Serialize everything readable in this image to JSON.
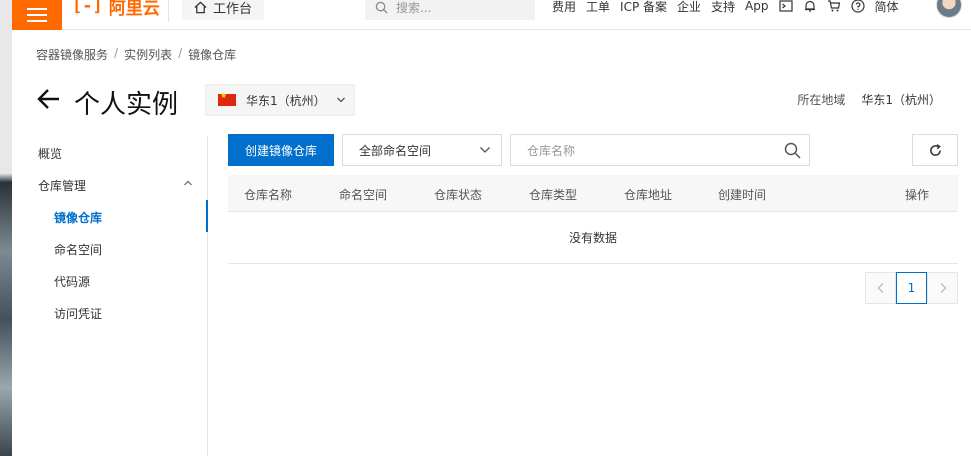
{
  "topbar": {
    "logo_mark": "[-]",
    "logo_text": "阿里云",
    "workbench_label": "工作台",
    "search_placeholder": "搜索...",
    "nav": [
      "费用",
      "工单",
      "ICP 备案",
      "企业",
      "支持",
      "App"
    ],
    "lang_label": "简体"
  },
  "breadcrumb": [
    "容器镜像服务",
    "实例列表",
    "镜像仓库"
  ],
  "page": {
    "title": "个人实例",
    "region_select": "华东1（杭州）",
    "region_meta_label": "所在地域",
    "region_meta_value": "华东1（杭州）"
  },
  "sidebar": {
    "items": [
      {
        "label": "概览"
      },
      {
        "label": "仓库管理"
      },
      {
        "label": "镜像仓库"
      },
      {
        "label": "命名空间"
      },
      {
        "label": "代码源"
      },
      {
        "label": "访问凭证"
      }
    ]
  },
  "toolbar": {
    "create_label": "创建镜像仓库",
    "namespace_select": "全部命名空间",
    "search_placeholder": "仓库名称"
  },
  "table": {
    "columns": [
      "仓库名称",
      "命名空间",
      "仓库状态",
      "仓库类型",
      "仓库地址",
      "创建时间",
      "操作"
    ],
    "empty_text": "没有数据"
  },
  "pagination": {
    "current_page": "1"
  },
  "colors": {
    "brand": "#ff6a00",
    "primary": "#0070cc"
  }
}
